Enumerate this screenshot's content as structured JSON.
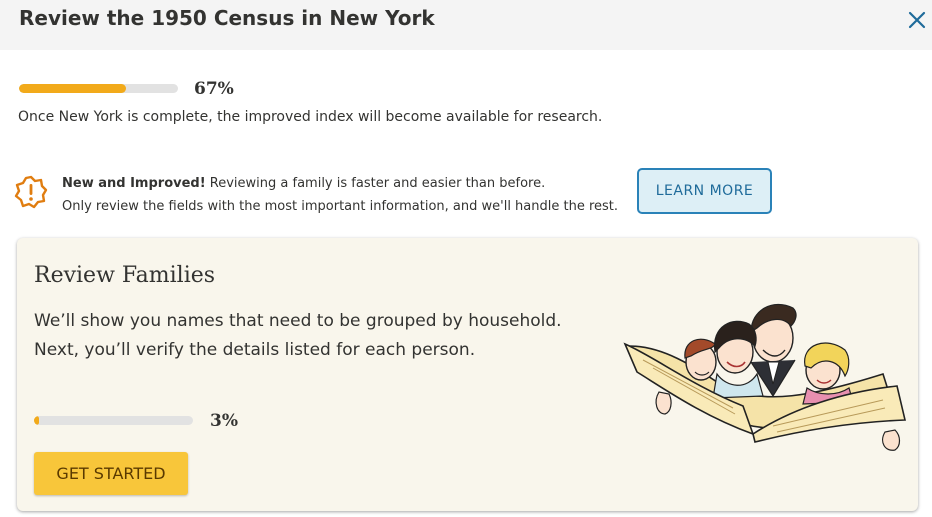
{
  "header": {
    "title": "Review the 1950 Census in New York",
    "close_icon": "close-icon"
  },
  "overall_progress": {
    "percent": 67,
    "label": "67%"
  },
  "description": "Once New York is complete, the improved index will become available for research.",
  "notice": {
    "icon": "warning-badge-icon",
    "bold": "New and Improved!",
    "line1": " Reviewing a family is faster and easier than before.",
    "line2": "Only review the fields with the most important information, and we'll handle the rest.",
    "button_label": "LEARN MORE"
  },
  "card": {
    "title": "Review Families",
    "text": "We’ll show you names that need to be grouped by household. Next, you’ll verify the details listed for each person.",
    "progress": {
      "percent": 3,
      "label": "3%"
    },
    "button_label": "GET STARTED",
    "illustration": "family-reading-newspaper-illustration"
  },
  "colors": {
    "progress_fill": "#f2aa1a",
    "accent_blue": "#2a82b8",
    "start_button": "#f8c63a",
    "card_bg": "#f9f6ec"
  }
}
